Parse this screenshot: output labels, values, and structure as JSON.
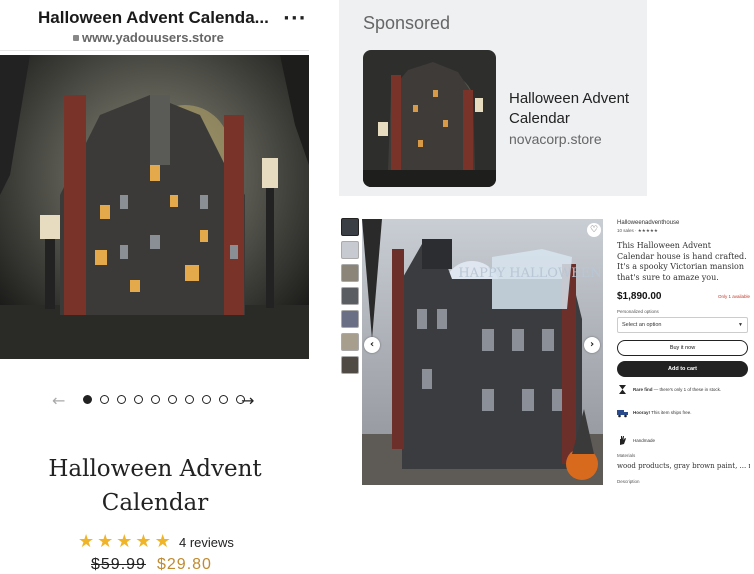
{
  "left_panel": {
    "title": "Halloween Advent Calenda...",
    "more_icon": "more-horizontal-icon",
    "url": "www.yadouusers.store",
    "carousel": {
      "dot_count": 10,
      "active_index": 0
    },
    "prev_arrow": "←",
    "next_arrow": "→",
    "product_name": "Halloween Advent Calendar",
    "rating": 5,
    "reviews": "4 reviews",
    "old_price": "$59.99",
    "new_price": "$29.80",
    "colors": {
      "star": "#f0b429",
      "sale_price": "#c08a2f"
    }
  },
  "sponsored": {
    "label": "Sponsored",
    "title": "Halloween Advent Calendar",
    "domain": "novacorp.store"
  },
  "listing": {
    "shop_name": "Halloweenadventhouse",
    "sales": "10 sales · ★★★★★",
    "description": "This Halloween Advent Calendar house is hand crafted. It's a spooky Victorian mansion that's sure to amaze you.",
    "price": "$1,890.00",
    "availability": "Only 1 available",
    "options_label": "Personalized options",
    "select_placeholder": "Select an option",
    "buy_now": "Buy it now",
    "add_to_cart": "Add to cart",
    "perk_rare_bold": "Rare find",
    "perk_rare_rest": " — there's only 1 of these in stock.",
    "perk_ship_bold": "Hooray!",
    "perk_ship_rest": " This item ships free.",
    "handmade": "Handmade",
    "materials_label": "Materials",
    "materials": "wood products, gray brown paint, ... more",
    "description_label": "Description",
    "photo_text": "HAPPY HALLOWEEN",
    "thumbnail_count": 7,
    "colors": {
      "availability": "#c0392b",
      "button_dark": "#222222"
    }
  }
}
